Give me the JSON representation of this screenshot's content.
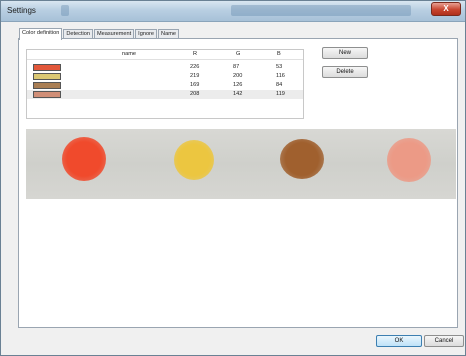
{
  "window": {
    "title": "Settings",
    "close_glyph": "X"
  },
  "tabs": [
    {
      "label": "Color definition",
      "active": true
    },
    {
      "label": "Detection",
      "active": false
    },
    {
      "label": "Measurement",
      "active": false
    },
    {
      "label": "Ignore",
      "active": false
    },
    {
      "label": "Name",
      "active": false
    }
  ],
  "table": {
    "columns": [
      "name",
      "R",
      "G",
      "B"
    ],
    "rows": [
      {
        "color": "#e2573a",
        "r": "226",
        "g": "87",
        "b": "53"
      },
      {
        "color": "#dbc874",
        "r": "219",
        "g": "200",
        "b": "116"
      },
      {
        "color": "#a97e54",
        "r": "169",
        "g": "126",
        "b": "84"
      },
      {
        "color": "#d08e77",
        "r": "208",
        "g": "142",
        "b": "119",
        "selected": true
      }
    ]
  },
  "side_buttons": {
    "new_label": "New",
    "delete_label": "Delete"
  },
  "preview": {
    "dots": [
      {
        "color": "#f04a2c"
      },
      {
        "color": "#ecc640"
      },
      {
        "color": "#a0602e"
      },
      {
        "color": "#ec9a86"
      }
    ]
  },
  "footer": {
    "ok_label": "OK",
    "cancel_label": "Cancel"
  }
}
